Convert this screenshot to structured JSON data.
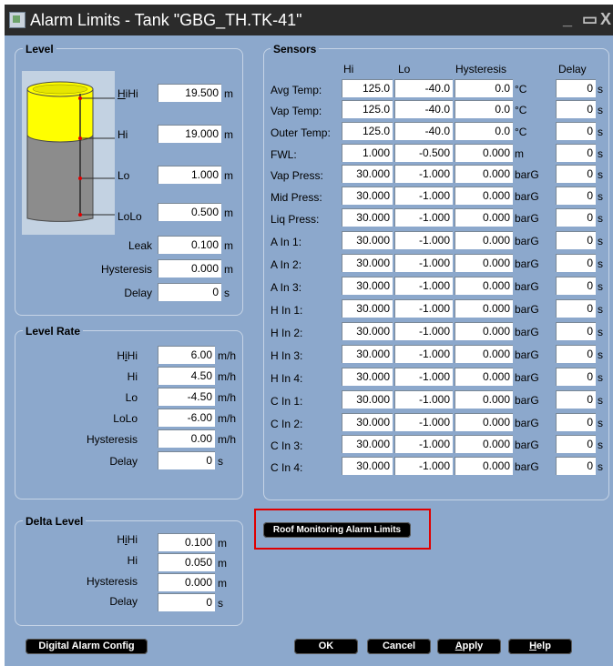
{
  "window": {
    "title": "Alarm Limits - Tank \"GBG_TH.TK-41\"",
    "minimize": "_",
    "restore": "▭",
    "close": "X"
  },
  "level": {
    "title": "Level",
    "fill_fraction": 0.38,
    "rows": [
      {
        "label": "HiHi",
        "value": "19.500",
        "unit": "m"
      },
      {
        "label": "Hi",
        "value": "19.000",
        "unit": "m"
      },
      {
        "label": "Lo",
        "value": "1.000",
        "unit": "m"
      },
      {
        "label": "LoLo",
        "value": "0.500",
        "unit": "m"
      },
      {
        "label": "Leak",
        "value": "0.100",
        "unit": "m"
      },
      {
        "label": "Hysteresis",
        "value": "0.000",
        "unit": "m"
      },
      {
        "label": "Delay",
        "value": "0",
        "unit": "s"
      }
    ]
  },
  "level_rate": {
    "title": "Level Rate",
    "rows": [
      {
        "label": "HiHi",
        "value": "6.00",
        "unit": "m/h"
      },
      {
        "label": "Hi",
        "value": "4.50",
        "unit": "m/h"
      },
      {
        "label": "Lo",
        "value": "-4.50",
        "unit": "m/h"
      },
      {
        "label": "LoLo",
        "value": "-6.00",
        "unit": "m/h"
      },
      {
        "label": "Hysteresis",
        "value": "0.00",
        "unit": "m/h"
      },
      {
        "label": "Delay",
        "value": "0",
        "unit": "s"
      }
    ]
  },
  "delta_level": {
    "title": "Delta Level",
    "rows": [
      {
        "label": "HiHi",
        "value": "0.100",
        "unit": "m"
      },
      {
        "label": "Hi",
        "value": "0.050",
        "unit": "m"
      },
      {
        "label": "Hysteresis",
        "value": "0.000",
        "unit": "m"
      },
      {
        "label": "Delay",
        "value": "0",
        "unit": "s"
      }
    ]
  },
  "sensors": {
    "title": "Sensors",
    "headers": {
      "hi": "Hi",
      "lo": "Lo",
      "hysteresis": "Hysteresis",
      "delay": "Delay"
    },
    "rows": [
      {
        "label": "Avg Temp:",
        "hi": "125.0",
        "lo": "-40.0",
        "hyst": "0.0",
        "unit": "°C",
        "delay": "0",
        "delay_unit": "s"
      },
      {
        "label": "Vap Temp:",
        "hi": "125.0",
        "lo": "-40.0",
        "hyst": "0.0",
        "unit": "°C",
        "delay": "0",
        "delay_unit": "s"
      },
      {
        "label": "Outer Temp:",
        "hi": "125.0",
        "lo": "-40.0",
        "hyst": "0.0",
        "unit": "°C",
        "delay": "0",
        "delay_unit": "s"
      },
      {
        "label": "FWL:",
        "hi": "1.000",
        "lo": "-0.500",
        "hyst": "0.000",
        "unit": "m",
        "delay": "0",
        "delay_unit": "s"
      },
      {
        "label": "Vap Press:",
        "hi": "30.000",
        "lo": "-1.000",
        "hyst": "0.000",
        "unit": "barG",
        "delay": "0",
        "delay_unit": "s"
      },
      {
        "label": "Mid Press:",
        "hi": "30.000",
        "lo": "-1.000",
        "hyst": "0.000",
        "unit": "barG",
        "delay": "0",
        "delay_unit": "s"
      },
      {
        "label": "Liq Press:",
        "hi": "30.000",
        "lo": "-1.000",
        "hyst": "0.000",
        "unit": "barG",
        "delay": "0",
        "delay_unit": "s"
      },
      {
        "label": "A In 1:",
        "hi": "30.000",
        "lo": "-1.000",
        "hyst": "0.000",
        "unit": "barG",
        "delay": "0",
        "delay_unit": "s"
      },
      {
        "label": "A In 2:",
        "hi": "30.000",
        "lo": "-1.000",
        "hyst": "0.000",
        "unit": "barG",
        "delay": "0",
        "delay_unit": "s"
      },
      {
        "label": "A In 3:",
        "hi": "30.000",
        "lo": "-1.000",
        "hyst": "0.000",
        "unit": "barG",
        "delay": "0",
        "delay_unit": "s"
      },
      {
        "label": "H In 1:",
        "hi": "30.000",
        "lo": "-1.000",
        "hyst": "0.000",
        "unit": "barG",
        "delay": "0",
        "delay_unit": "s"
      },
      {
        "label": "H In 2:",
        "hi": "30.000",
        "lo": "-1.000",
        "hyst": "0.000",
        "unit": "barG",
        "delay": "0",
        "delay_unit": "s"
      },
      {
        "label": "H In 3:",
        "hi": "30.000",
        "lo": "-1.000",
        "hyst": "0.000",
        "unit": "barG",
        "delay": "0",
        "delay_unit": "s"
      },
      {
        "label": "H In 4:",
        "hi": "30.000",
        "lo": "-1.000",
        "hyst": "0.000",
        "unit": "barG",
        "delay": "0",
        "delay_unit": "s"
      },
      {
        "label": "C In 1:",
        "hi": "30.000",
        "lo": "-1.000",
        "hyst": "0.000",
        "unit": "barG",
        "delay": "0",
        "delay_unit": "s"
      },
      {
        "label": "C In 2:",
        "hi": "30.000",
        "lo": "-1.000",
        "hyst": "0.000",
        "unit": "barG",
        "delay": "0",
        "delay_unit": "s"
      },
      {
        "label": "C In 3:",
        "hi": "30.000",
        "lo": "-1.000",
        "hyst": "0.000",
        "unit": "barG",
        "delay": "0",
        "delay_unit": "s"
      },
      {
        "label": "C In 4:",
        "hi": "30.000",
        "lo": "-1.000",
        "hyst": "0.000",
        "unit": "barG",
        "delay": "0",
        "delay_unit": "s"
      }
    ]
  },
  "buttons": {
    "roof_monitoring": "Roof Monitoring Alarm Limits",
    "digital_alarm_config": "Digital Alarm Config",
    "ok": "OK",
    "cancel": "Cancel",
    "apply": "Apply",
    "help": "Help"
  },
  "colors": {
    "window_bg": "#8ca8cc",
    "titlebar": "#2b2b2b",
    "tank_liquid": "#ffff00",
    "tank_body": "#8c8c8c",
    "highlight": "#e00000"
  }
}
